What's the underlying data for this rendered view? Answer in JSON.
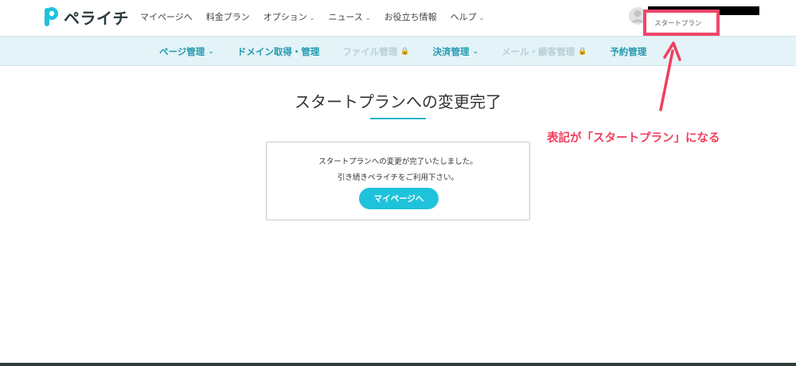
{
  "header": {
    "logo_text": "ペライチ",
    "nav": [
      {
        "label": "マイページへ",
        "has_dropdown": false
      },
      {
        "label": "料金プラン",
        "has_dropdown": false
      },
      {
        "label": "オプション",
        "has_dropdown": true
      },
      {
        "label": "ニュース",
        "has_dropdown": true
      },
      {
        "label": "お役立ち情報",
        "has_dropdown": false
      },
      {
        "label": "ヘルプ",
        "has_dropdown": true
      }
    ],
    "plan_label": "スタートプラン"
  },
  "subnav": [
    {
      "label": "ページ管理",
      "state": "dropdown"
    },
    {
      "label": "ドメイン取得・管理",
      "state": "normal"
    },
    {
      "label": "ファイル管理",
      "state": "locked"
    },
    {
      "label": "決済管理",
      "state": "dropdown"
    },
    {
      "label": "メール・顧客管理",
      "state": "locked"
    },
    {
      "label": "予約管理",
      "state": "normal"
    }
  ],
  "main": {
    "title": "スタートプランへの変更完了",
    "message_line1": "スタートプランへの変更が完了いたしました。",
    "message_line2": "引き続きペライチをご利用下さい。",
    "button_label": "マイページへ"
  },
  "annotation": {
    "text": "表記が「スタートプラン」になる",
    "color": "#ef3e5c"
  },
  "colors": {
    "accent": "#1ec3db",
    "subnav_bg": "#e3f3f7",
    "highlight": "#f0466a"
  }
}
